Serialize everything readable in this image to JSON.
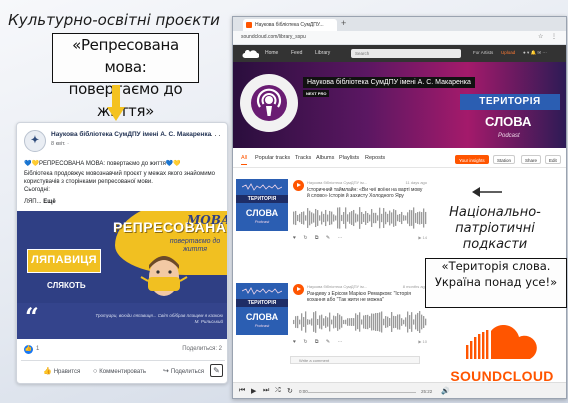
{
  "callout_top": {
    "title": "Культурно-освітні проєкти",
    "lines": [
      "«Репресована мова:",
      "повертаємо до життя»"
    ]
  },
  "facebook_post": {
    "page_name": "Наукова бібліотека СумДПУ імені А. С. Макаренка",
    "time": "8 квіт. ·",
    "more": "···",
    "headline": "💙💛РЕПРЕСОВАНА МОВА: повертаємо до життя💙💛",
    "body": "Бібліотека продовжує мовознавчий проєкт у межах якого знайомимо користувачів з сторінками репресованої мови.",
    "body2": "Сьогодні:",
    "body3": "ЛЯП...",
    "see_more": "Ещё",
    "banner": {
      "title": "РЕПРЕСОВАНА",
      "mova": "МОВА",
      "subtitle": "повертаємо до життя",
      "word": "ЛЯПАВИЦЯ",
      "meaning": "СЛЯКОТЬ",
      "quote": "Тротуари, всюди ляпавиця... Світ обібрав плащем я казкою",
      "quote_author": "М. Рильський"
    },
    "likes": "1",
    "shares": "Поделиться: 2",
    "actions": {
      "like": "Нравится",
      "comment": "Комментировать",
      "share": "Поделиться"
    }
  },
  "browser": {
    "tab_title": "Наукова бібліотека СумДПУ...",
    "url": "soundcloud.com/library_sspu",
    "nav": {
      "home": "Home",
      "feed": "Feed",
      "library": "Library",
      "search_placeholder": "Search",
      "for_artists": "For Artists",
      "upload": "Upload"
    },
    "profile": {
      "name": "Наукова бібліотека СумДПУ імені А. С. Макаренка",
      "badge": "NEXT PRO",
      "banner_title": "ТЕРИТОРІЯ",
      "banner_word": "СЛОВА",
      "banner_sub": "Podcast"
    },
    "tabs": [
      "All",
      "Popular tracks",
      "Tracks",
      "Albums",
      "Playlists",
      "Reposts"
    ],
    "active_tab": "All",
    "buttons": {
      "insights": "Your insights",
      "station": "Station",
      "share": "Share",
      "edit": "Edit"
    },
    "tracks": [
      {
        "user": "Наукова бібліотека СумДПУ ім...",
        "date": "11 days ago",
        "title": "Історичний таймлайн: «Ви чиї воїни на варті мову й слово» Історія й захисту Холодного Яру",
        "plays": "▶ 14"
      },
      {
        "user": "Наукова бібліотека СумДПУ ім...",
        "date": "8 months ago",
        "title": "Рандеву з Ерісом Марією Ремарком: \"Історія кохання або \"Так жити не можна\"",
        "plays": "▶ 10"
      }
    ],
    "comment_placeholder": "Write a comment",
    "player": {
      "time_current": "0:00",
      "time_total": "25:22"
    },
    "art": {
      "line1": "ТЕРИТОРІЯ",
      "line2": "СЛОВА",
      "line3": "Podcast"
    }
  },
  "callout_right": {
    "lines": [
      "Національно-",
      "патріотичні",
      "подкасти"
    ],
    "box_lines": [
      "«Територія слова.",
      "Україна понад усе!»"
    ]
  },
  "soundcloud_brand": "SOUNDCLOUD",
  "colors": {
    "accent_orange": "#ff5500",
    "fb_blue": "#1877f2",
    "banner_navy": "#2f3f84",
    "banner_yellow": "#f1c021"
  }
}
